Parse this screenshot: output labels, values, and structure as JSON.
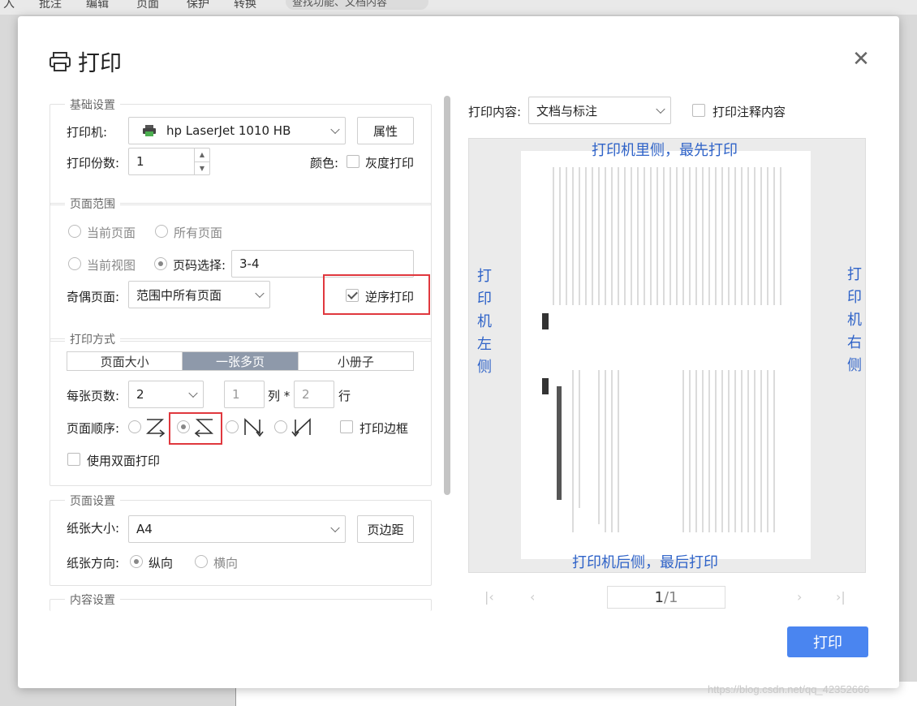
{
  "appbar": {
    "items": [
      "入",
      "批注",
      "编辑",
      "页面",
      "保护",
      "转换"
    ],
    "search": "查找功能、文档内容"
  },
  "watermark": "https://blog.csdn.net/qq_42352666",
  "dialog": {
    "title": "打印"
  },
  "basic": {
    "legend": "基础设置",
    "printer_label": "打印机:",
    "printer_value": "hp LaserJet 1010 HB",
    "properties_button": "属性",
    "copies_label": "打印份数:",
    "copies_value": "1",
    "color_label": "颜色:",
    "grayscale_label": "灰度打印"
  },
  "range": {
    "legend": "页面范围",
    "current_page": "当前页面",
    "all_pages": "所有页面",
    "current_view": "当前视图",
    "page_select_label": "页码选择:",
    "page_select_value": "3-4",
    "odd_even_label": "奇偶页面:",
    "odd_even_value": "范围中所有页面",
    "reverse_label": "逆序打印"
  },
  "mode": {
    "legend": "打印方式",
    "tabs": [
      "页面大小",
      "一张多页",
      "小册子"
    ],
    "per_sheet_label": "每张页数:",
    "per_sheet_value": "2",
    "cols_value": "1",
    "cols_unit": "列 *",
    "rows_value": "2",
    "rows_unit": "行",
    "order_label": "页面顺序:",
    "border_label": "打印边框",
    "duplex_label": "使用双面打印"
  },
  "page_setup": {
    "legend": "页面设置",
    "paper_label": "纸张大小:",
    "paper_value": "A4",
    "margin_button": "页边距",
    "orient_label": "纸张方向:",
    "portrait": "纵向",
    "landscape": "横向"
  },
  "content": {
    "legend": "内容设置"
  },
  "right": {
    "content_label": "打印内容:",
    "content_value": "文档与标注",
    "annot_label": "打印注释内容",
    "top_note": "打印机里侧，最先打印",
    "bottom_note": "打印机后侧，最后打印",
    "left_note": "打印机左侧",
    "right_note": "打印机右侧",
    "page_current": "1",
    "page_total": "/1",
    "print_button": "打印"
  }
}
